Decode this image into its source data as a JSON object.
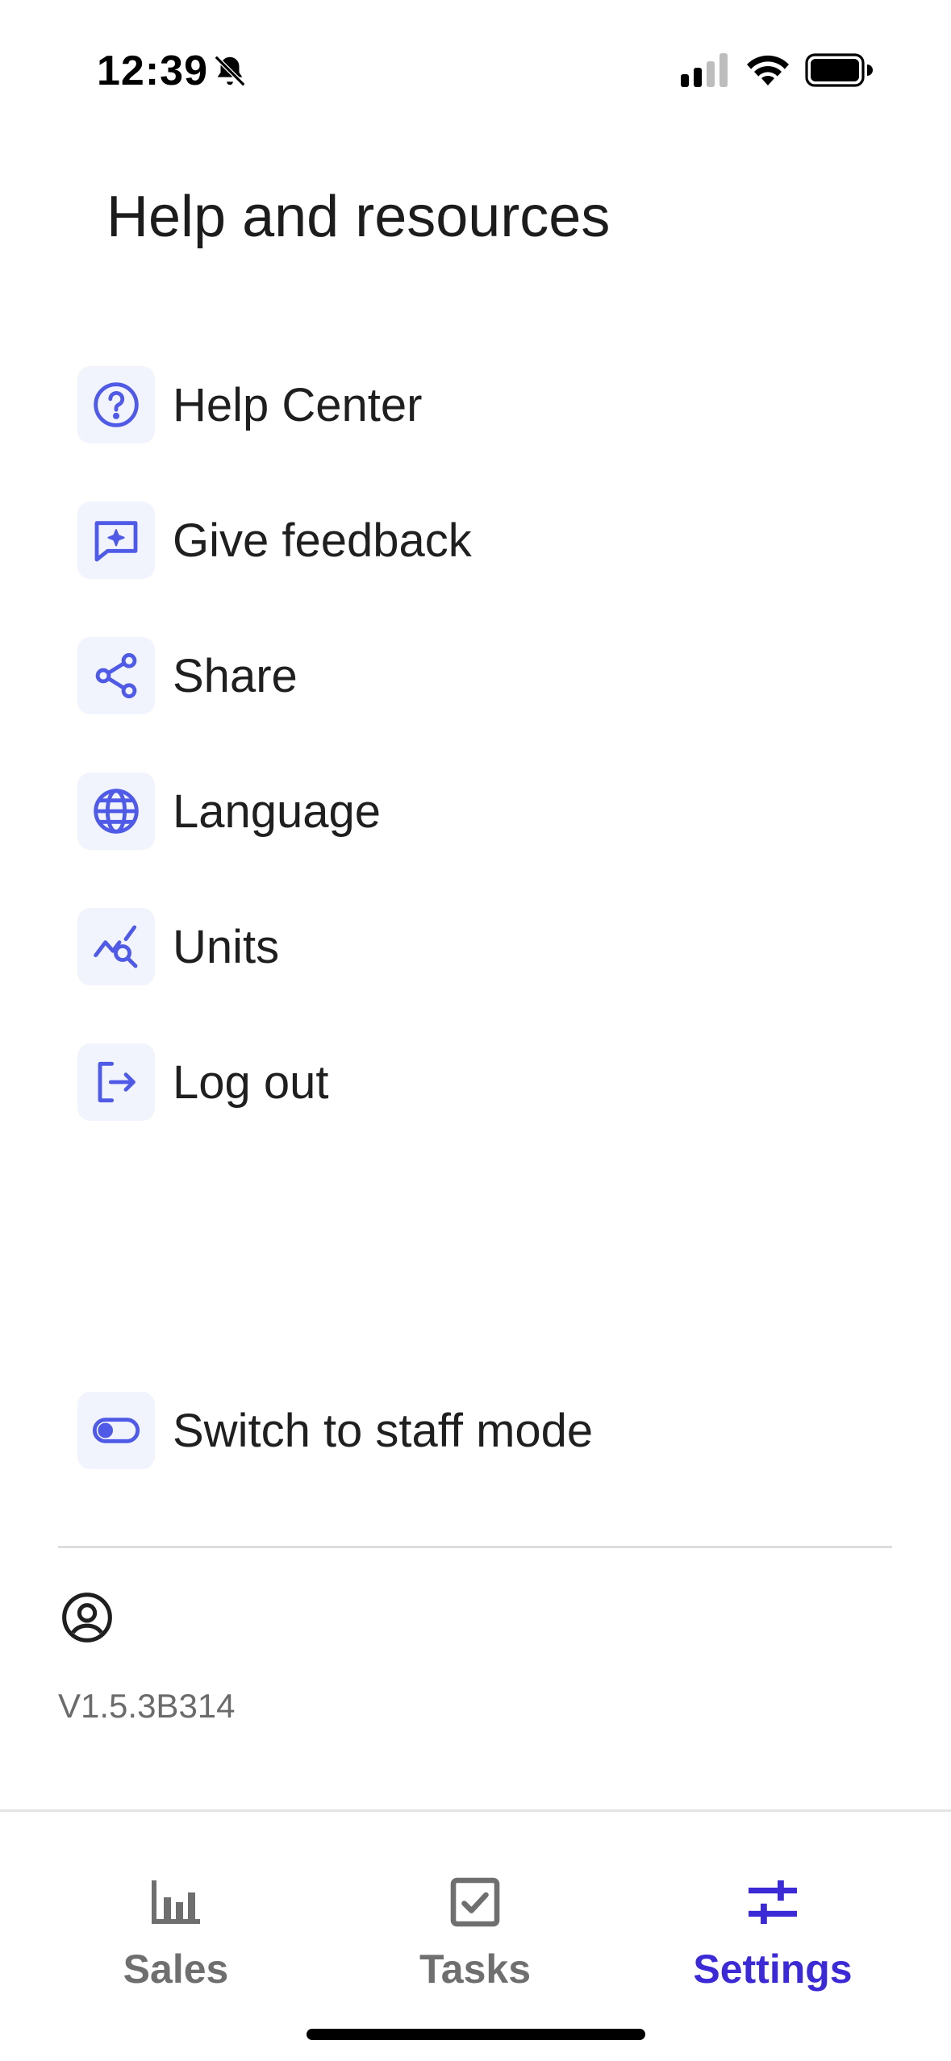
{
  "status_bar": {
    "time": "12:39"
  },
  "title": "Help and resources",
  "menu": [
    {
      "label": "Help Center",
      "icon": "question-circle-icon"
    },
    {
      "label": "Give feedback",
      "icon": "feedback-icon"
    },
    {
      "label": "Share",
      "icon": "share-icon"
    },
    {
      "label": "Language",
      "icon": "globe-icon"
    },
    {
      "label": "Units",
      "icon": "chart-search-icon"
    },
    {
      "label": "Log out",
      "icon": "logout-icon"
    }
  ],
  "staff_mode": {
    "label": "Switch to staff mode",
    "icon": "toggle-icon"
  },
  "version": "V1.5.3B314",
  "tabs": [
    {
      "label": "Sales",
      "icon": "bar-chart-icon",
      "active": false
    },
    {
      "label": "Tasks",
      "icon": "checkbox-icon",
      "active": false
    },
    {
      "label": "Settings",
      "icon": "sliders-icon",
      "active": true
    }
  ],
  "colors": {
    "accent": "#3b2ad6",
    "icon": "#4f5ae6",
    "icon_bg": "#f1f3fd",
    "inactive_tab": "#6f6f6f"
  }
}
